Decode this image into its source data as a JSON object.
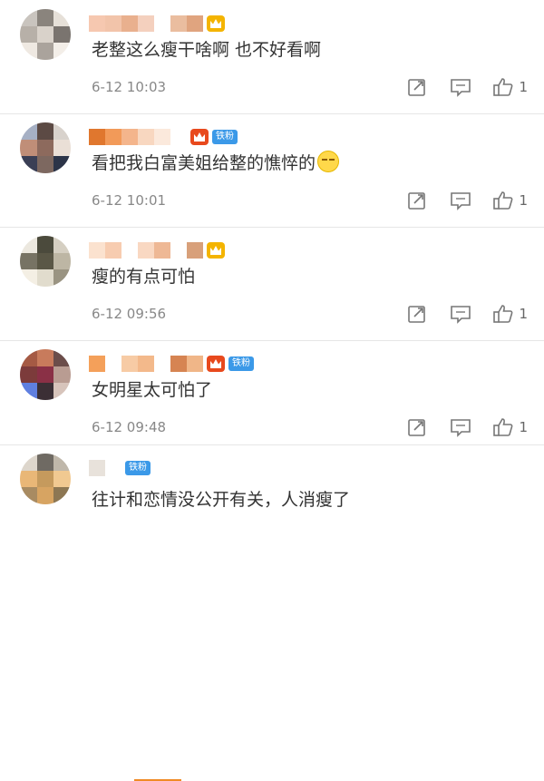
{
  "comments": [
    {
      "avatar_colors": [
        "#c9c4be",
        "#8a847d",
        "#e6e0d8",
        "#b7b0a8",
        "#d9d2ca",
        "#7a746f",
        "#efe9e2",
        "#aaa39c",
        "#f3eee8"
      ],
      "name_blocks": [
        "#f6c8b0",
        "#f2c4aa",
        "#e9b08e",
        "#f4d0be",
        "#ffffff",
        "#eabd9f",
        "#e0a47f"
      ],
      "badge": "crown-gold",
      "text": "老整这么瘦干啥啊 也不好看啊",
      "time": "6-12 10:03",
      "likes": "1",
      "icons": [
        "share-icon",
        "comment-icon",
        "like-icon"
      ]
    },
    {
      "avatar_colors": [
        "#a6b0c4",
        "#5c4a44",
        "#d8d2cc",
        "#c08e78",
        "#8d6a5d",
        "#eadfd6",
        "#3a3f55",
        "#7d6860",
        "#2c3448"
      ],
      "name_blocks": [
        "#e0772e",
        "#f29a59",
        "#f4b58c",
        "#f8d7c0",
        "#fbe9dc",
        "#ffffff"
      ],
      "badge": "crown-red",
      "fan_label": "铁粉",
      "text": "看把我白富美姐给整的憔悴的",
      "time": "6-12 10:01",
      "likes": "1"
    },
    {
      "avatar_colors": [
        "#ece8df",
        "#4b4a3c",
        "#d5cfc2",
        "#777364",
        "#5a5746",
        "#bdb6a4",
        "#f4efe4",
        "#e1dccd",
        "#9a9482"
      ],
      "name_blocks": [
        "#fbe2cf",
        "#f7ccb0",
        "#ffffff",
        "#f9d8c2",
        "#eeb895",
        "#ffffff",
        "#d8a07a"
      ],
      "badge": "crown-gold",
      "text": "瘦的有点可怕",
      "time": "6-12 09:56",
      "likes": "1"
    },
    {
      "avatar_colors": [
        "#a55a44",
        "#c87b5c",
        "#6b4d4a",
        "#7c3b3b",
        "#8a3046",
        "#b99c92",
        "#5f7fe0",
        "#3b2f35",
        "#d7c4bb"
      ],
      "name_blocks": [
        "#f4a05a",
        "#ffffff",
        "#f7cba5",
        "#f3b98b",
        "#ffffff",
        "#d68452",
        "#f0b688"
      ],
      "badge": "crown-red",
      "fan_label": "铁粉",
      "text": "女明星太可怕了",
      "time": "6-12 09:48",
      "likes": "1",
      "time_highlight_color": "#f08a24"
    },
    {
      "avatar_colors": [
        "#ddd6cc",
        "#6f6a63",
        "#bfb7aa",
        "#e9b777",
        "#c59a5d",
        "#f1c991",
        "#a88b62",
        "#d7a462",
        "#8d7753"
      ],
      "name_blocks": [
        "#e8e2db",
        "#ffffff"
      ],
      "badge": "fan",
      "fan_label": "铁粉",
      "text": "往计和恋情没公开有关，人消瘦了"
    }
  ]
}
